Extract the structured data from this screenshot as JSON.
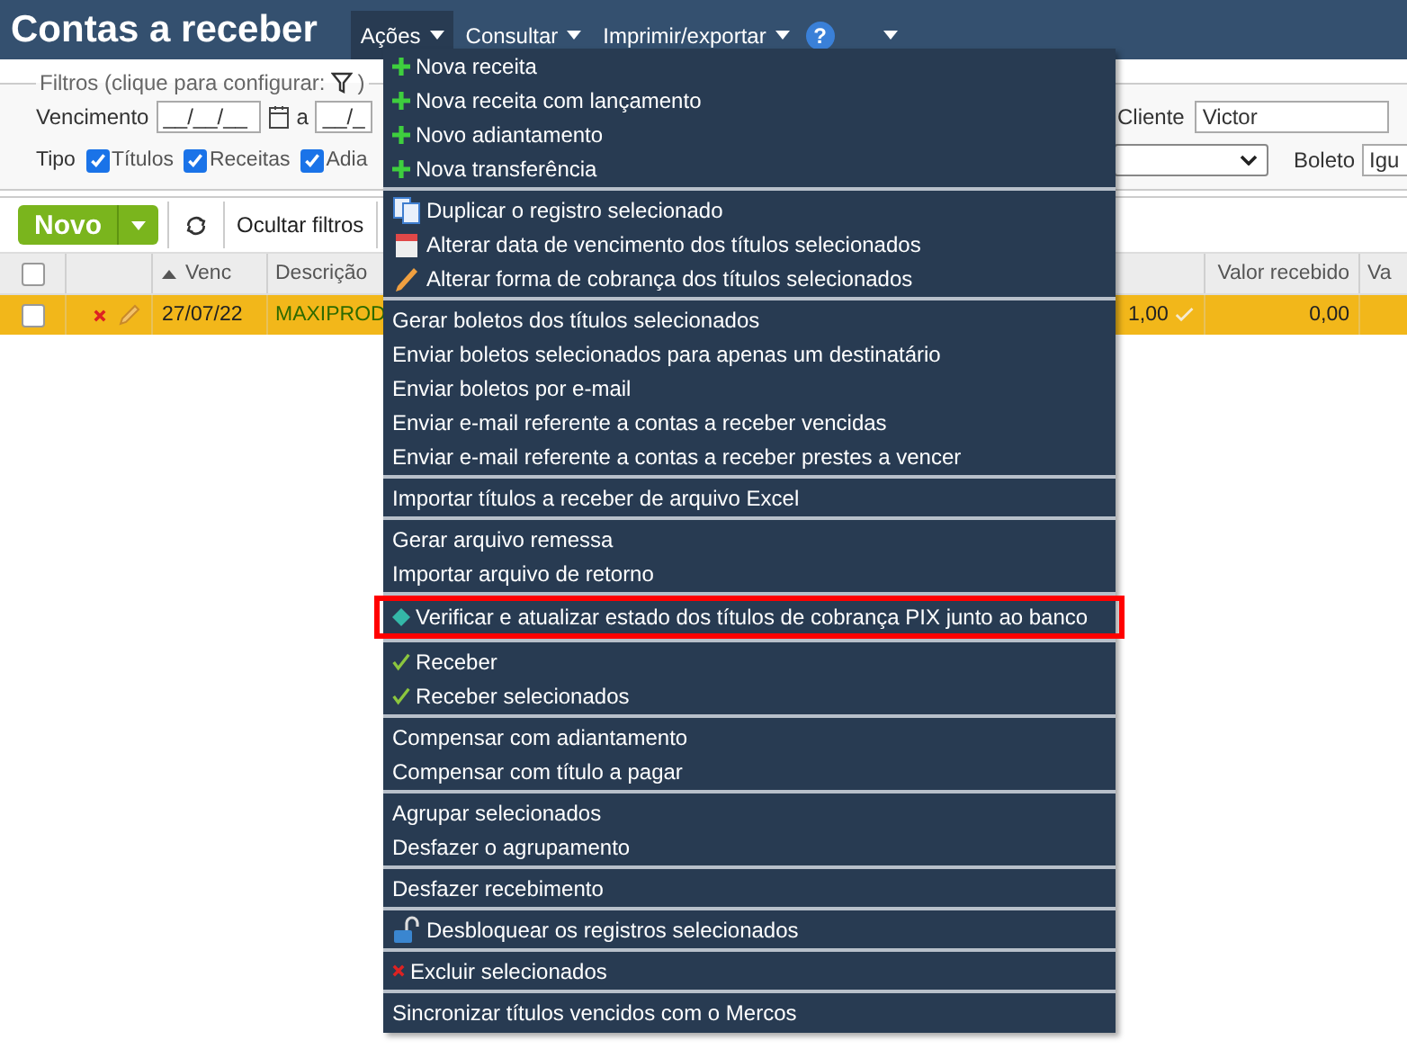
{
  "header": {
    "title": "Contas a receber",
    "menus": [
      {
        "label": "Ações",
        "selected": true
      },
      {
        "label": "Consultar",
        "selected": false
      },
      {
        "label": "Imprimir/exportar",
        "selected": false
      }
    ],
    "help": "?"
  },
  "filters": {
    "legend": "Filtros (clique para configurar:",
    "legend_end": ")",
    "vencimento_label": "Vencimento",
    "date_from": "__/__/__",
    "separator": "a",
    "date_to": "__/_",
    "cliente_label": "Cliente",
    "cliente_value": "Victor",
    "tipo_label": "Tipo",
    "tipos": [
      {
        "label": "Títulos",
        "checked": true
      },
      {
        "label": "Receitas",
        "checked": true
      },
      {
        "label": "Adia",
        "checked": true
      }
    ],
    "boleto_label": "Boleto",
    "boleto_value": "Igu"
  },
  "toolbar": {
    "new_button": "Novo",
    "hide_filters": "Ocultar filtros"
  },
  "table": {
    "select_all_checked": false,
    "columns_left": [
      "Venc",
      "Descrição"
    ],
    "columns_right": [
      "Valor recebido",
      "Va"
    ],
    "rows": [
      {
        "selected": true,
        "checked": false,
        "venc": "27/07/22",
        "descricao": "MAXIPROD",
        "valor": "1,00",
        "valor_recebido": "0,00"
      }
    ]
  },
  "menu": {
    "groups": [
      [
        {
          "label": "Nova receita",
          "highlighted": false
        },
        {
          "label": "Nova receita com lançamento",
          "highlighted": false
        },
        {
          "label": "Novo adiantamento",
          "highlighted": false
        },
        {
          "label": "Nova transferência",
          "highlighted": false
        }
      ],
      [
        {
          "label": "Duplicar o registro selecionado",
          "highlighted": false
        },
        {
          "label": "Alterar data de vencimento dos títulos selecionados",
          "highlighted": false
        },
        {
          "label": "Alterar forma de cobrança dos títulos selecionados",
          "highlighted": false
        }
      ],
      [
        {
          "label": "Gerar boletos dos títulos selecionados",
          "highlighted": false
        },
        {
          "label": "Enviar boletos selecionados para apenas um destinatário",
          "highlighted": false
        },
        {
          "label": "Enviar boletos por e-mail",
          "highlighted": false
        },
        {
          "label": "Enviar e-mail referente a contas a receber vencidas",
          "highlighted": false
        },
        {
          "label": "Enviar e-mail referente a contas a receber prestes a vencer",
          "highlighted": false
        }
      ],
      [
        {
          "label": "Importar títulos a receber de arquivo Excel",
          "highlighted": false
        }
      ],
      [
        {
          "label": "Gerar arquivo remessa",
          "highlighted": false
        },
        {
          "label": "Importar arquivo de retorno",
          "highlighted": false
        }
      ],
      [
        {
          "label": "Verificar e atualizar estado dos títulos de cobrança PIX junto ao banco",
          "highlighted": true
        }
      ],
      [
        {
          "label": "Receber",
          "highlighted": false
        },
        {
          "label": "Receber selecionados",
          "highlighted": false
        }
      ],
      [
        {
          "label": "Compensar com adiantamento",
          "highlighted": false
        },
        {
          "label": "Compensar com título a pagar",
          "highlighted": false
        }
      ],
      [
        {
          "label": "Agrupar selecionados",
          "highlighted": false
        },
        {
          "label": "Desfazer o agrupamento",
          "highlighted": false
        }
      ],
      [
        {
          "label": "Desfazer recebimento",
          "highlighted": false
        }
      ],
      [
        {
          "label": "Desbloquear os registros selecionados",
          "highlighted": false
        }
      ],
      [
        {
          "label": "Excluir selecionados",
          "highlighted": false
        }
      ],
      [
        {
          "label": "Sincronizar títulos vencidos com o Mercos",
          "highlighted": false
        }
      ]
    ]
  }
}
